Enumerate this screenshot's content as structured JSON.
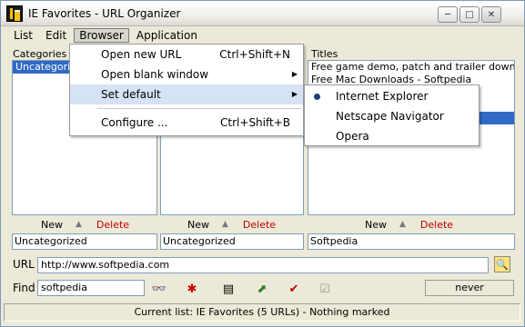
{
  "window": {
    "title": "IE Favorites - URL Organizer",
    "minimize": "─",
    "maximize": "□",
    "close": "✕"
  },
  "menubar": {
    "list": "List",
    "edit": "Edit",
    "browser": "Browser",
    "application": "Application"
  },
  "panels": {
    "categories": {
      "label": "Categories",
      "items": [
        "Uncategorized"
      ],
      "status": "Uncategorized"
    },
    "middle": {
      "items": [],
      "status": "Uncategorized"
    },
    "titles": {
      "label": "Titles",
      "items": [
        "Free game demo, patch and trailer downloads - So",
        "Free Mac Downloads - Softpedia",
        "",
        ""
      ],
      "status": "Softpedia"
    },
    "new_label": "New",
    "sort_glyph": "▲",
    "delete_label": "Delete"
  },
  "url": {
    "label": "URL",
    "value": "http://www.softpedia.com"
  },
  "find": {
    "label": "Find",
    "value": "softpedia",
    "date": "never"
  },
  "status": {
    "text": "Current list: IE Favorites (5 URLs)  -  Nothing marked"
  },
  "browser_menu": {
    "items": [
      {
        "label": "Open new URL",
        "shortcut": "Ctrl+Shift+N"
      },
      {
        "label": "Open blank window",
        "shortcut": ""
      },
      {
        "label": "Set default",
        "shortcut": ""
      },
      {
        "label": "Configure ...",
        "shortcut": "Ctrl+Shift+B"
      }
    ]
  },
  "default_submenu": {
    "items": [
      "Internet Explorer",
      "Netscape Navigator",
      "Opera"
    ],
    "selected": "Internet Explorer"
  },
  "colors": {
    "selection": "#316ac5",
    "delete": "#c00000",
    "menu_highlight": "#d6e2f5"
  }
}
